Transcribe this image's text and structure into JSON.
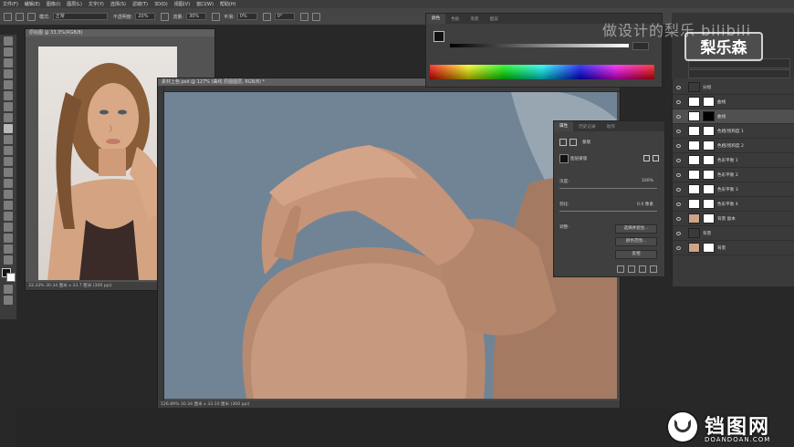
{
  "menu": [
    "文件(F)",
    "编辑(E)",
    "图像(I)",
    "图层(L)",
    "文字(Y)",
    "选择(S)",
    "滤镜(T)",
    "3D(D)",
    "视图(V)",
    "窗口(W)",
    "帮助(H)"
  ],
  "options": {
    "mode_label": "模式:",
    "mode_value": "正常",
    "opacity_label": "不透明度:",
    "opacity_value": "20%",
    "flow_label": "流量:",
    "flow_value": "30%",
    "smooth_label": "平滑:",
    "smooth_value": "0%",
    "angle_value": "0°"
  },
  "doc1": {
    "title": "原始图 @ 33.3%(RGB/8)",
    "status": "33.33%  30.34 厘米 x 33.7 厘米 (300 ppi)"
  },
  "doc2": {
    "title": "素材上色.psd @ 127% (曲线 原图图层, RGB/8) *",
    "status": "126.89%  30.34 厘米 x 33.10 厘米 (300 ppi)"
  },
  "color_panel": {
    "tabs": [
      "颜色",
      "色板",
      "渐变",
      "图案"
    ]
  },
  "properties": {
    "tabs": [
      "属性",
      "历史记录",
      "动作"
    ],
    "header": "蒙版",
    "mask_label": "图层蒙版",
    "density_label": "浓度:",
    "density_value": "100%",
    "feather_label": "羽化:",
    "feather_value": "0.0 像素",
    "refine_label": "调整:",
    "buttons": [
      "选择并遮住...",
      "颜色范围...",
      "反相"
    ]
  },
  "layers": [
    {
      "name": "分组",
      "type": "group"
    },
    {
      "name": "曲线",
      "type": "curves"
    },
    {
      "name": "曲线",
      "type": "curves",
      "selected": true
    },
    {
      "name": "色相/饱和度 1",
      "type": "hsl"
    },
    {
      "name": "色相/饱和度 2",
      "type": "hsl"
    },
    {
      "name": "色彩平衡 1",
      "type": "balance"
    },
    {
      "name": "色彩平衡 2",
      "type": "balance"
    },
    {
      "name": "色彩平衡 3",
      "type": "balance"
    },
    {
      "name": "色彩平衡 4",
      "type": "balance"
    },
    {
      "name": "背景 副本",
      "type": "pixel"
    },
    {
      "name": "背景",
      "type": "group"
    },
    {
      "name": "背景",
      "type": "pixel"
    }
  ],
  "watermark": {
    "text": "做设计的梨乐 bilibili",
    "logo": "梨乐森"
  },
  "footer": {
    "site_cn": "铛图网",
    "site_en": "DOANDOAN.COM"
  }
}
